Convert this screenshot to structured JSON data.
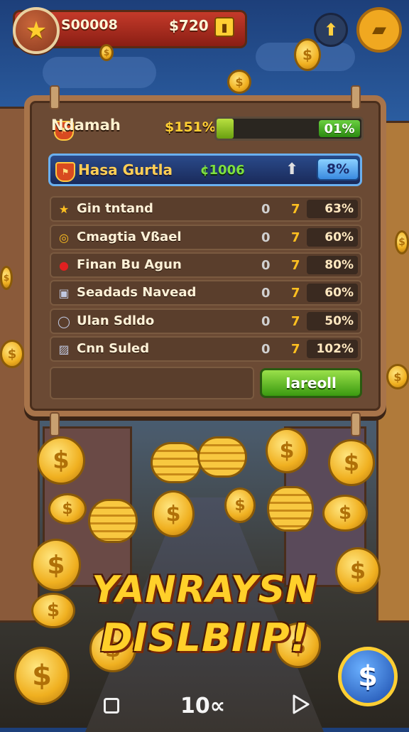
{
  "hud": {
    "score": "S00008",
    "money": "$720"
  },
  "panel": {
    "header": {
      "name": "Ndamah",
      "value": "$151%",
      "progress_label": "01%",
      "progress_fraction": 0.12
    },
    "highlight": {
      "name": "Hasa Gurtla",
      "value": "¢1006",
      "pill": "8%"
    },
    "rows": [
      {
        "name": "Gin tntand",
        "a": "0",
        "b": "7",
        "pct": "63%"
      },
      {
        "name": "Cmagtia Vßael",
        "a": "0",
        "b": "7",
        "pct": "60%"
      },
      {
        "name": "Finan Bu Agun",
        "a": "0",
        "b": "7",
        "pct": "80%"
      },
      {
        "name": "Seadads Navead",
        "a": "0",
        "b": "7",
        "pct": "60%"
      },
      {
        "name": "Ulan Sdldo",
        "a": "0",
        "b": "7",
        "pct": "50%"
      },
      {
        "name": "Cnn Suled",
        "a": "0",
        "b": "7",
        "pct": "102%"
      }
    ],
    "button": "Iareoll"
  },
  "title": {
    "line1": "YANRAYSN",
    "line2": "DISLBIIP!"
  },
  "nav": {
    "center": "10∝"
  },
  "colors": {
    "gold": "#ffcf33",
    "panel": "#6b4a34",
    "green": "#6ad040",
    "highlight": "#2a4a8a"
  }
}
